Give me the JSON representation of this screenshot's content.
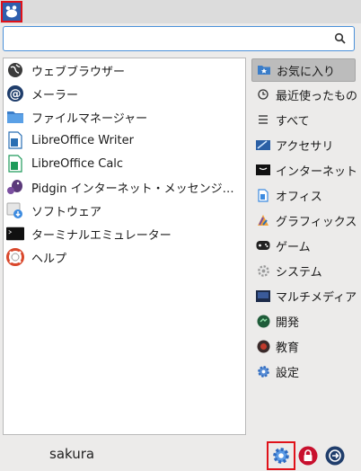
{
  "search": {
    "value": "",
    "placeholder": ""
  },
  "apps": [
    {
      "label": "ウェブブラウザー",
      "icon": "globe-icon"
    },
    {
      "label": "メーラー",
      "icon": "mail-at-icon"
    },
    {
      "label": "ファイルマネージャー",
      "icon": "folder-icon"
    },
    {
      "label": "LibreOffice Writer",
      "icon": "writer-icon"
    },
    {
      "label": "LibreOffice Calc",
      "icon": "calc-icon"
    },
    {
      "label": "Pidgin インターネット・メッセンジ…",
      "icon": "pidgin-icon"
    },
    {
      "label": "ソフトウェア",
      "icon": "software-icon"
    },
    {
      "label": "ターミナルエミュレーター",
      "icon": "terminal-icon"
    },
    {
      "label": "ヘルプ",
      "icon": "help-lifebuoy-icon"
    }
  ],
  "categories": [
    {
      "label": "お気に入り",
      "icon": "favorites-folder-icon",
      "selected": true
    },
    {
      "label": "最近使ったもの",
      "icon": "clock-icon"
    },
    {
      "label": "すべて",
      "icon": "list-icon"
    },
    {
      "label": "アクセサリ",
      "icon": "accessories-icon"
    },
    {
      "label": "インターネット",
      "icon": "internet-icon"
    },
    {
      "label": "オフィス",
      "icon": "office-icon"
    },
    {
      "label": "グラフィックス",
      "icon": "graphics-icon"
    },
    {
      "label": "ゲーム",
      "icon": "gamepad-icon"
    },
    {
      "label": "システム",
      "icon": "system-gear-icon"
    },
    {
      "label": "マルチメディア",
      "icon": "multimedia-icon"
    },
    {
      "label": "開発",
      "icon": "development-icon"
    },
    {
      "label": "教育",
      "icon": "education-icon"
    },
    {
      "label": "設定",
      "icon": "settings-icon"
    }
  ],
  "footer": {
    "username": "sakura"
  },
  "colors": {
    "accent": "#4a90d9",
    "highlight_border": "#e0121a",
    "lock": "#c8102e",
    "logout": "#1f3d6b"
  }
}
